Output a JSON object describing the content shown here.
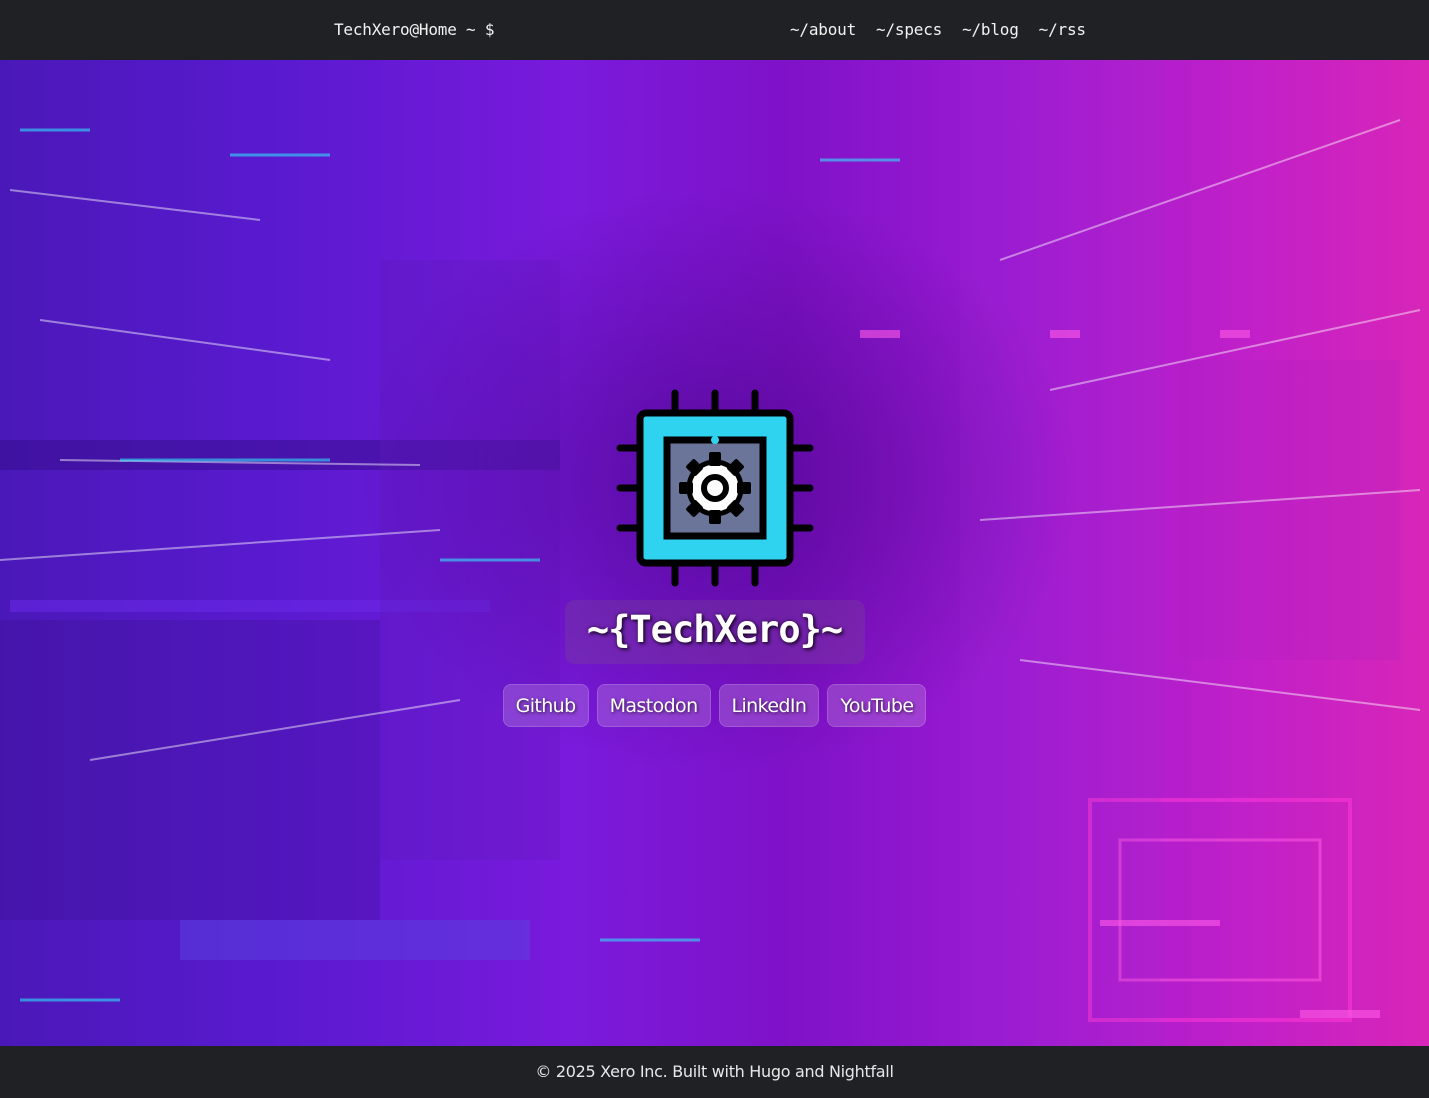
{
  "header": {
    "site_prompt": "TechXero@Home ~ $",
    "nav": [
      {
        "label": "~/about"
      },
      {
        "label": "~/specs"
      },
      {
        "label": "~/blog"
      },
      {
        "label": "~/rss"
      }
    ]
  },
  "hero": {
    "logo_icon": "cpu-gear-icon",
    "title": "~{TechXero}~",
    "links": [
      {
        "label": "Github"
      },
      {
        "label": "Mastodon"
      },
      {
        "label": "LinkedIn"
      },
      {
        "label": "YouTube"
      }
    ]
  },
  "footer": {
    "text": "© 2025 Xero Inc. Built with Hugo and Nightfall"
  },
  "colors": {
    "bar_bg": "#202124",
    "chip_cyan": "#2fd3f0",
    "chip_core": "#6b7499",
    "hero_purple": "#7a1adc",
    "hero_magenta": "#d826b8"
  }
}
